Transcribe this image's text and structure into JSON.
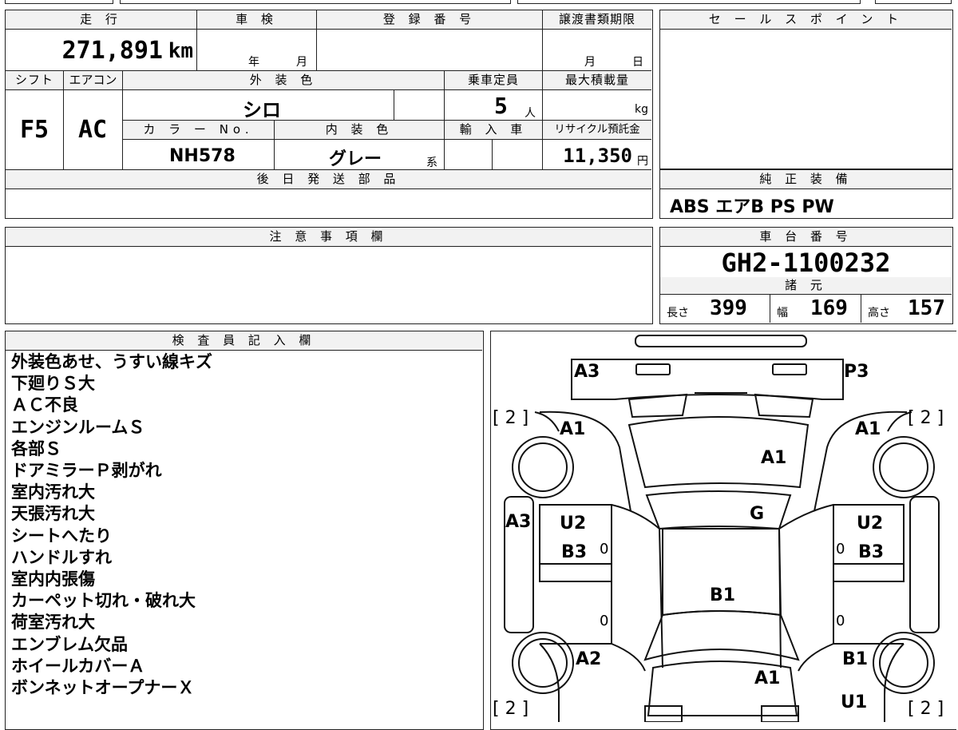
{
  "vehicle": {
    "mileage_label": "走 行",
    "mileage": "271,891",
    "mileage_unit": "km",
    "inspection_label": "車 検",
    "year_unit": "年",
    "month_unit": "月",
    "registration_label": "登 録 番 号",
    "transfer_deadline_label": "譲渡書類期限",
    "transfer_month": "月",
    "transfer_day": "日",
    "shift_label": "シフト",
    "shift": "F5",
    "ac_label": "エアコン",
    "ac": "AC",
    "exterior_color_label": "外 装 色",
    "exterior_color": "シロ",
    "capacity_label": "乗車定員",
    "capacity": "5",
    "capacity_unit": "人",
    "max_load_label": "最大積載量",
    "max_load_unit": "kg",
    "color_no_label": "カ ラ ー No.",
    "color_no": "NH578",
    "interior_color_label": "内 装 色",
    "interior_color": "グレー",
    "interior_suffix": "系",
    "import_label": "輸 入 車",
    "recycle_label": "リサイクル預託金",
    "recycle_fee": "11,350",
    "recycle_unit": "円"
  },
  "later_parts_label": "後 日 発 送 部 品",
  "sales_point_label": "セ ー ル ス ポ イ ン ト",
  "equipment_label": "純 正 装 備",
  "equipment": "ABS エアB PS PW",
  "notes_label": "注 意 事 項 欄",
  "chassis_label": "車 台 番 号",
  "chassis_no": "GH2-1100232",
  "specs_label": "諸 元",
  "specs": {
    "length_label": "長さ",
    "length": "399",
    "width_label": "幅",
    "width": "169",
    "height_label": "高さ",
    "height": "157"
  },
  "inspector_label": "検 査 員 記 入 欄",
  "remarks": [
    "外装色あせ、うすい線キズ",
    "下廻りＳ大",
    "ＡＣ不良",
    "エンジンルームＳ",
    "各部Ｓ",
    "ドアミラーＰ剥がれ",
    "室内汚れ大",
    "天張汚れ大",
    "シートへたり",
    "ハンドルすれ",
    "室内内張傷",
    "カーペット切れ・破れ大",
    "荷室汚れ大",
    "エンブレム欠品",
    "ホイールカバーＡ",
    "ボンネットオープナーＸ"
  ],
  "diagram": {
    "tire_fl": "[ 2 ]",
    "tire_fr": "[ 2 ]",
    "tire_rl": "[ 2 ]",
    "tire_rr": "[ 2 ]",
    "marks": {
      "front_bumper_left": "A3",
      "front_bumper_right": "P3",
      "fender_fl": "A1",
      "fender_fr": "A1",
      "hood": "A1",
      "windshield": "G",
      "side_left": "A3",
      "door_fl_1": "U2",
      "door_fl_2": "B3",
      "door_fr_1": "U2",
      "door_fr_2": "B3",
      "roof": "B1",
      "quarter_rl": "A2",
      "quarter_rr": "B1",
      "rear": "A1",
      "rear_right": "U1",
      "zero": "0"
    }
  }
}
